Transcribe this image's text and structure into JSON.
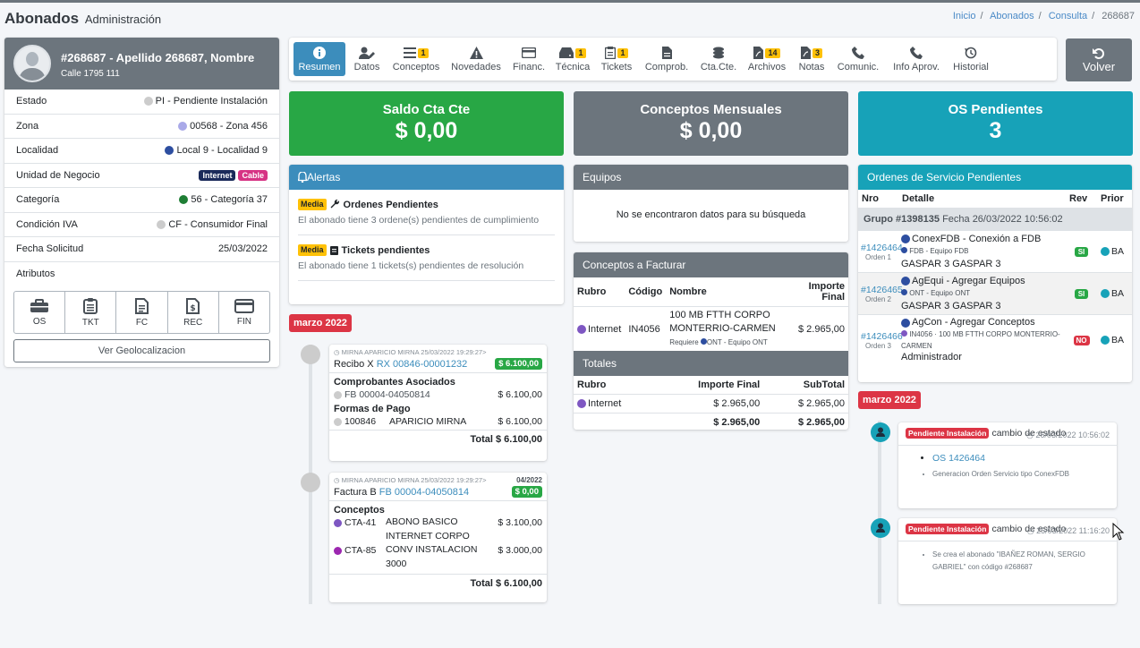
{
  "header": {
    "title": "Abonados",
    "subtitle": "Administración",
    "breadcrumb": [
      "Inicio",
      "Abonados",
      "Consulta",
      "268687"
    ]
  },
  "profile": {
    "name": "#268687 - Apellido 268687, Nombre",
    "address": "Calle 1795 111",
    "rows": [
      {
        "label": "Estado",
        "value": "PI - Pendiente Instalación",
        "dot": "#cccccc"
      },
      {
        "label": "Zona",
        "value": "00568 - Zona 456",
        "dot": "#a9a9e8"
      },
      {
        "label": "Localidad",
        "value": "Local 9 - Localidad 9",
        "dot": "#2d4ea0"
      },
      {
        "label": "Unidad de Negocio",
        "badges": [
          {
            "text": "Internet",
            "color": "#1a2a5a"
          },
          {
            "text": "Cable",
            "color": "#d63384"
          }
        ]
      },
      {
        "label": "Categoría",
        "value": "56 - Categoría 37",
        "dot": "#1e7e34"
      },
      {
        "label": "Condición IVA",
        "value": "CF - Consumidor Final",
        "dot": "#cccccc"
      },
      {
        "label": "Fecha Solicitud",
        "value": "25/03/2022"
      },
      {
        "label": "Atributos"
      }
    ],
    "attributes": [
      {
        "label": "OS",
        "icon": "briefcase-icon"
      },
      {
        "label": "TKT",
        "icon": "clipboard-icon"
      },
      {
        "label": "FC",
        "icon": "invoice-icon"
      },
      {
        "label": "REC",
        "icon": "receipt-icon"
      },
      {
        "label": "FIN",
        "icon": "credit-card-icon"
      }
    ],
    "geo_button": "Ver Geolocalizacion"
  },
  "tabs": [
    {
      "label": "Resumen",
      "icon": "info-icon",
      "active": true
    },
    {
      "label": "Datos",
      "icon": "user-edit-icon"
    },
    {
      "label": "Conceptos",
      "icon": "list-icon",
      "count": "1"
    },
    {
      "label": "Novedades",
      "icon": "warning-icon"
    },
    {
      "label": "Financ.",
      "icon": "credit-card-icon"
    },
    {
      "label": "Técnica",
      "icon": "hdd-icon",
      "count": "1"
    },
    {
      "label": "Tickets",
      "icon": "clipboard-icon",
      "count": "1"
    },
    {
      "label": "Comprob.",
      "icon": "file-icon"
    },
    {
      "label": "Cta.Cte.",
      "icon": "coins-icon"
    },
    {
      "label": "Archivos",
      "icon": "pdf-icon",
      "count": "14"
    },
    {
      "label": "Notas",
      "icon": "pdf-icon",
      "count": "3"
    },
    {
      "label": "Comunic.",
      "icon": "phone-icon"
    },
    {
      "label": "Info Aprov.",
      "icon": "phone-icon"
    },
    {
      "label": "Historial",
      "icon": "history-icon"
    }
  ],
  "volver": "Volver",
  "stats": [
    {
      "title": "Saldo Cta Cte",
      "value": "$ 0,00",
      "color": "#28a745"
    },
    {
      "title": "Conceptos Mensuales",
      "value": "$ 0,00",
      "color": "#6c757d"
    },
    {
      "title": "OS Pendientes",
      "value": "3",
      "color": "#17a2b8"
    }
  ],
  "alertas": {
    "title": "Alertas",
    "items": [
      {
        "badge": "Media",
        "title": "Ordenes Pendientes",
        "text": "El abonado tiene 3 ordene(s) pendientes de cumplimiento"
      },
      {
        "badge": "Media",
        "title": "Tickets pendientes",
        "text": "El abonado tiene 1 tickets(s) pendientes de resolución"
      }
    ]
  },
  "timeline_left": {
    "month": "marzo 2022",
    "entries": [
      {
        "meta": "MIRNA APARICIO MIRNA 25/03/2022 19:29:27>",
        "doc_prefix": "Recibo X",
        "doc_link": "RX 00846-00001232",
        "amount": "$ 6.100,00",
        "sections": [
          {
            "title": "Comprobantes Asociados",
            "rows": [
              {
                "code": "FB 00004-04050814",
                "desc": "",
                "amount": "$ 6.100,00",
                "dot": "#cccccc"
              }
            ]
          },
          {
            "title": "Formas de Pago",
            "rows": [
              {
                "code": "100846",
                "desc": "APARICIO MIRNA",
                "amount": "$ 6.100,00",
                "dot": "#cccccc"
              }
            ]
          }
        ],
        "total": "Total $ 6.100,00"
      },
      {
        "meta": "MIRNA APARICIO MIRNA 25/03/2022 19:29:27>",
        "period": "04/2022",
        "doc_prefix": "Factura B",
        "doc_link": "FB 00004-04050814",
        "amount": "$ 0,00",
        "sections": [
          {
            "title": "Conceptos",
            "rows": [
              {
                "code": "CTA-41",
                "desc": "ABONO BASICO INTERNET CORPO",
                "amount": "$ 3.100,00",
                "dot": "#7e57c2"
              },
              {
                "code": "CTA-85",
                "desc": "CONV INSTALACION 3000",
                "amount": "$ 3.000,00",
                "dot": "#9c27b0"
              }
            ]
          }
        ],
        "total": "Total $ 6.100,00"
      }
    ]
  },
  "equipos": {
    "title": "Equipos",
    "empty": "No se encontraron datos para su búsqueda"
  },
  "conceptos": {
    "title": "Conceptos a Facturar",
    "headers": [
      "Rubro",
      "Código",
      "Nombre",
      "Importe Final"
    ],
    "rows": [
      {
        "rubro": "Internet",
        "codigo": "IN4056",
        "nombre": "100 MB FTTH CORPO MONTERRIO-CARMEN",
        "requiere_label": "Requiere",
        "requiere": "ONT - Equipo ONT",
        "importe": "$ 2.965,00"
      }
    ]
  },
  "totales": {
    "title": "Totales",
    "headers": [
      "Rubro",
      "Importe Final",
      "SubTotal"
    ],
    "rows": [
      {
        "rubro": "Internet",
        "importe": "$ 2.965,00",
        "subtotal": "$ 2.965,00"
      }
    ],
    "footer": {
      "importe": "$ 2.965,00",
      "subtotal": "$ 2.965,00"
    }
  },
  "ordenes": {
    "title": "Ordenes de Servicio Pendientes",
    "headers": [
      "Nro",
      "Detalle",
      "Rev",
      "Prior"
    ],
    "group": {
      "label": "Grupo #1398135",
      "date": "Fecha 26/03/2022 10:56:02"
    },
    "rows": [
      {
        "nro": "#1426464",
        "orden": "Orden 1",
        "title": "ConexFDB - Conexión a FDB",
        "sub": "FDB - Equipo FDB",
        "person": "GASPAR 3 GASPAR 3",
        "rev": "SI",
        "prior": "BA"
      },
      {
        "nro": "#1426465",
        "orden": "Orden 2",
        "title": "AgEqui - Agregar Equipos",
        "sub": "ONT - Equipo ONT",
        "person": "GASPAR 3 GASPAR 3",
        "rev": "SI",
        "prior": "BA"
      },
      {
        "nro": "#1426466",
        "orden": "Orden 3",
        "title": "AgCon - Agregar Conceptos",
        "sub": "IN4056 · 100 MB FTTH CORPO MONTERRIO-CARMEN",
        "person": "Administrador",
        "rev": "NO",
        "prior": "BA"
      }
    ]
  },
  "timeline_right": {
    "month": "marzo 2022",
    "entries": [
      {
        "badge": "Pendiente Instalación",
        "action": "cambio de estado",
        "time": "26/03/2022 10:56:02",
        "link": "OS 1426464",
        "note": "Generacion Orden Servicio tipo ConexFDB"
      },
      {
        "badge": "Pendiente Instalación",
        "action": "cambio de estado",
        "time": "25/03/2022 11:16:20",
        "note": "Se crea el abonado \"IBAÑEZ ROMAN, SERGIO GABRIEL\" con código #268687"
      }
    ]
  }
}
